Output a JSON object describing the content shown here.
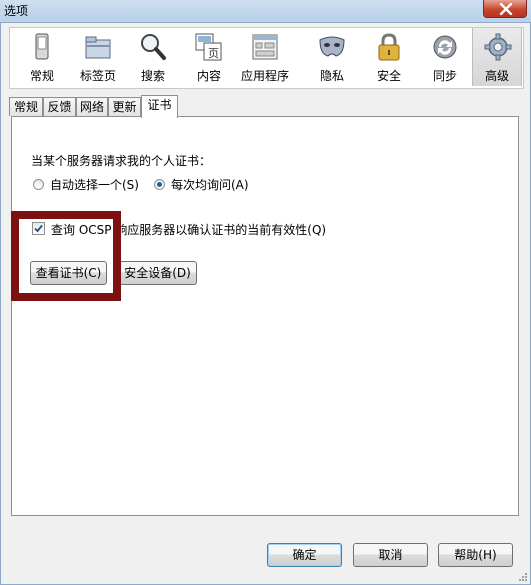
{
  "window": {
    "title": "选项"
  },
  "toolbar": {
    "items": [
      {
        "label": "常规",
        "icon": "phone-icon"
      },
      {
        "label": "标签页",
        "icon": "tabs-folder-icon"
      },
      {
        "label": "搜索",
        "icon": "magnifier-icon"
      },
      {
        "label": "内容",
        "icon": "content-page-icon"
      },
      {
        "label": "应用程序",
        "icon": "applications-icon"
      },
      {
        "label": "隐私",
        "icon": "mask-icon"
      },
      {
        "label": "安全",
        "icon": "padlock-icon"
      },
      {
        "label": "同步",
        "icon": "sync-icon"
      },
      {
        "label": "高级",
        "icon": "gear-icon"
      }
    ],
    "selected": "高级"
  },
  "tabs": {
    "items": [
      "常规",
      "反馈",
      "网络",
      "更新",
      "证书"
    ],
    "active": "证书"
  },
  "cert": {
    "prompt": "当某个服务器请求我的个人证书：",
    "radio_auto": "自动选择一个(S)",
    "radio_ask": "每次均询问(A)",
    "selected_radio": "每次均询问(A)",
    "ocsp_label": "查询 OCSP 响应服务器以确认证书的当前有效性(Q)",
    "ocsp_checked": true,
    "view_certs_button": "查看证书(C)",
    "security_devices_button": "安全设备(D)"
  },
  "footer": {
    "ok": "确定",
    "cancel": "取消",
    "help": "帮助(H)"
  },
  "colors": {
    "highlight_border": "#7d1010",
    "accent": "#1f5fa8"
  }
}
